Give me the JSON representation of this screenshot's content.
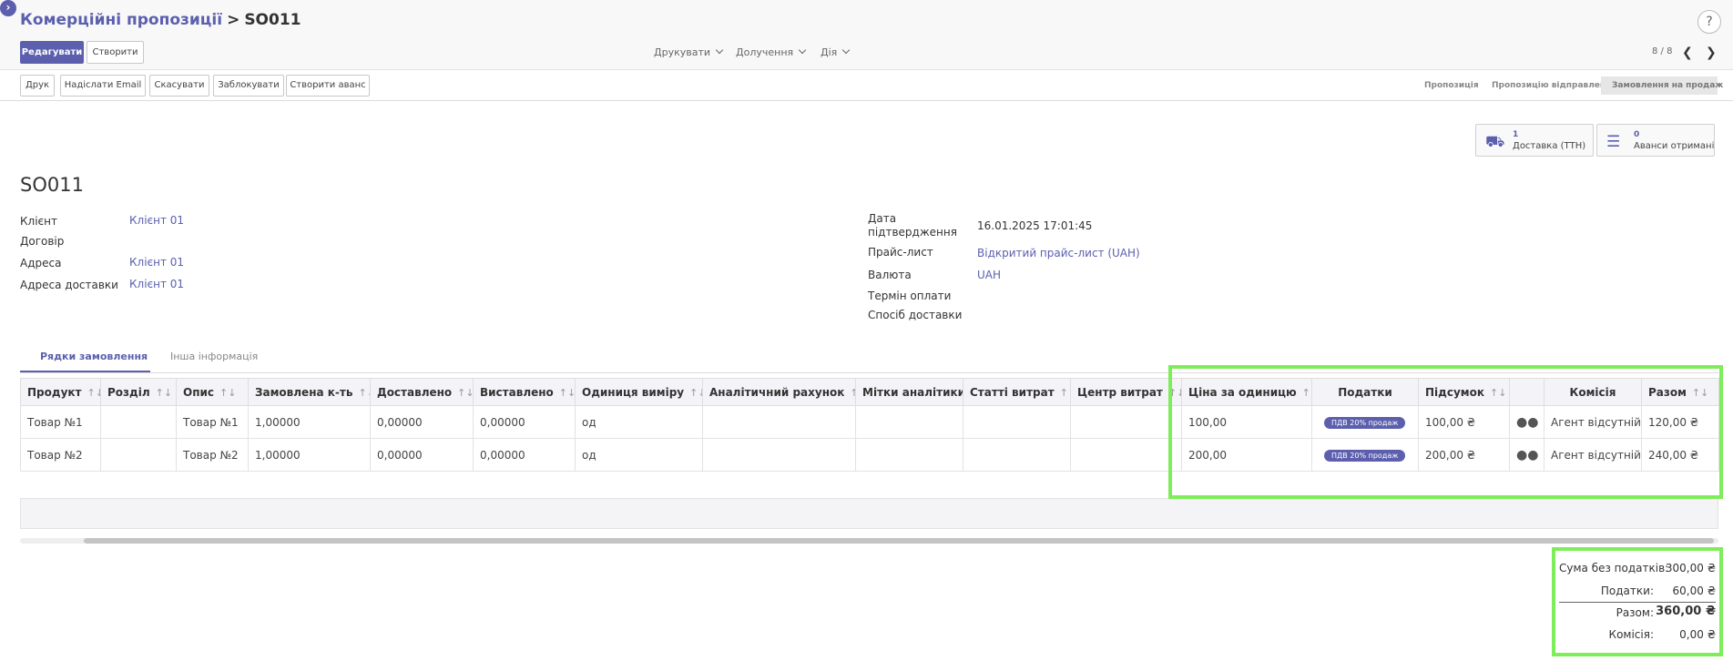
{
  "breadcrumb": {
    "parent": "Комерційні пропозиції",
    "separator": ">",
    "current": "SO011"
  },
  "help": "?",
  "toolbar": {
    "edit": "Редагувати",
    "create": "Створити"
  },
  "menus": {
    "print": "Друкувати",
    "attachments": "Долучення",
    "action": "Дія"
  },
  "pager": {
    "text": "8 / 8",
    "prev": "❮",
    "next": "❯"
  },
  "actions": {
    "print": "Друк",
    "send_email": "Надіслати Email",
    "cancel": "Скасувати",
    "lock": "Заблокувати",
    "create_advance": "Створити аванс"
  },
  "stages": {
    "proposal": "Пропозиція",
    "proposal_sent": "Пропозицію відправлено",
    "sale_order": "Замовлення на продаж"
  },
  "smart_buttons": {
    "delivery": {
      "count": "1",
      "label": "Доставка (ТТН)"
    },
    "advances": {
      "count": "0",
      "label": "Аванси отримані"
    }
  },
  "record": {
    "title": "SO011",
    "left": {
      "client_label": "Клієнт",
      "client_value": "Клієнт 01",
      "contract_label": "Договір",
      "address_label": "Адреса",
      "address_value": "Клієнт 01",
      "delivery_address_label": "Адреса доставки",
      "delivery_address_value": "Клієнт 01"
    },
    "right": {
      "confirm_date_label_1": "Дата",
      "confirm_date_label_2": "підтвердження",
      "confirm_date_value": "16.01.2025 17:01:45",
      "pricelist_label": "Прайс-лист",
      "pricelist_value": "Відкритий прайс-лист (UAH)",
      "currency_label": "Валюта",
      "currency_value": "UAH",
      "payment_term_label": "Термін оплати",
      "delivery_method_label": "Спосіб доставки"
    }
  },
  "tabs": {
    "order_lines": "Рядки замовлення",
    "other_info": "Інша інформація"
  },
  "table": {
    "sort_glyph": "↑↓",
    "headers": {
      "product": "Продукт",
      "section": "Розділ",
      "description": "Опис",
      "ordered_qty": "Замовлена к-ть",
      "delivered": "Доставлено",
      "invoiced": "Виставлено",
      "uom": "Одиниця виміру",
      "analytic_account": "Аналітичний рахунок",
      "analytic_tags": "Мітки аналітики",
      "expense_items": "Статті витрат",
      "cost_center": "Центр витрат",
      "unit_price": "Ціна за одиницю",
      "taxes": "Податки",
      "subtotal": "Підсумок",
      "commission": "Комісія",
      "total": "Разом"
    },
    "rows": [
      {
        "product": "Товар №1",
        "section": "",
        "description": "Товар №1",
        "ordered_qty": "1,00000",
        "delivered": "0,00000",
        "invoiced": "0,00000",
        "uom": "од",
        "analytic_account": "",
        "analytic_tags": "",
        "expense_items": "",
        "cost_center": "",
        "unit_price": "100,00",
        "tax": "ПДВ 20% продаж",
        "subtotal": "100,00 ₴",
        "commission": "Агент відсутній",
        "total": "120,00 ₴"
      },
      {
        "product": "Товар №2",
        "section": "",
        "description": "Товар №2",
        "ordered_qty": "1,00000",
        "delivered": "0,00000",
        "invoiced": "0,00000",
        "uom": "од",
        "analytic_account": "",
        "analytic_tags": "",
        "expense_items": "",
        "cost_center": "",
        "unit_price": "200,00",
        "tax": "ПДВ 20% продаж",
        "subtotal": "200,00 ₴",
        "commission": "Агент відсутній",
        "total": "240,00 ₴"
      }
    ]
  },
  "totals": {
    "untaxed_label": "Сума без податків:",
    "untaxed_value": "300,00 ₴",
    "taxes_label": "Податки:",
    "taxes_value": "60,00 ₴",
    "total_label": "Разом:",
    "total_value": "360,00 ₴",
    "commission_label": "Комісія:",
    "commission_value": "0,00 ₴"
  },
  "colors": {
    "accent": "#5b5fae",
    "highlight": "#7ded5a"
  }
}
